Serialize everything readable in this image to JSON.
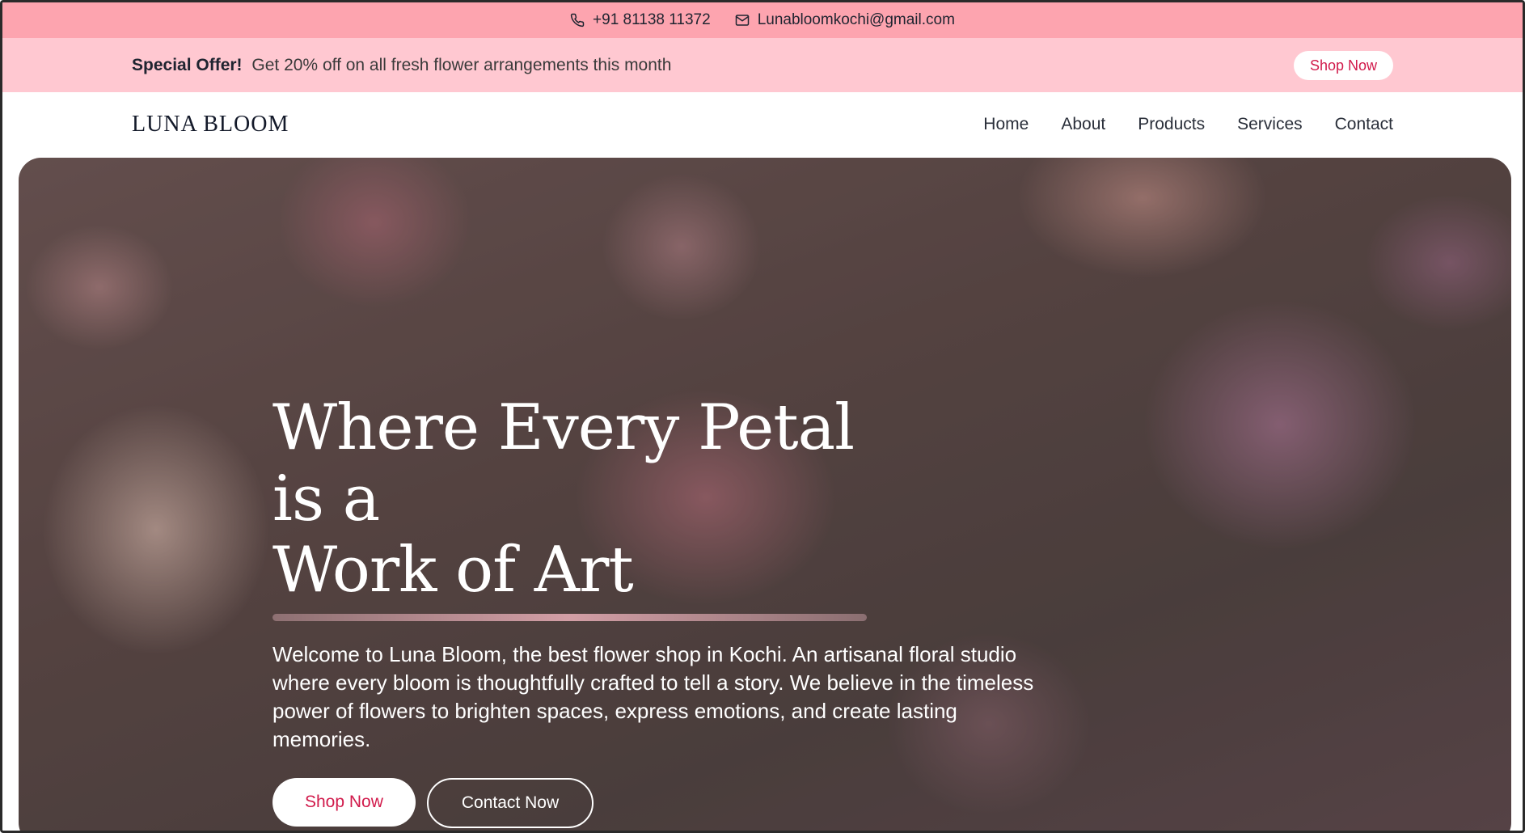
{
  "topbar": {
    "phone": "+91 81138 11372",
    "email": "Lunabloomkochi@gmail.com",
    "phone_icon": "phone-icon",
    "email_icon": "mail-icon"
  },
  "offer": {
    "label": "Special Offer!",
    "text": "Get 20% off on all fresh flower arrangements this month",
    "button": "Shop Now"
  },
  "nav": {
    "logo": "LUNA BLOOM",
    "items": [
      {
        "label": "Home"
      },
      {
        "label": "About"
      },
      {
        "label": "Products"
      },
      {
        "label": "Services"
      },
      {
        "label": "Contact"
      }
    ]
  },
  "hero": {
    "title_line1": "Where Every Petal is a",
    "title_line2": "Work of Art",
    "description": "Welcome to Luna Bloom, the best flower shop in Kochi. An artisanal floral studio where every bloom is thoughtfully crafted to tell a story. We believe in the timeless power of flowers to brighten spaces, express emotions, and create lasting memories.",
    "primary_button": "Shop Now",
    "secondary_button": "Contact Now"
  },
  "colors": {
    "topbar_bg": "#fda4af",
    "offer_bg": "#ffc8d1",
    "accent": "#d11a4b"
  }
}
